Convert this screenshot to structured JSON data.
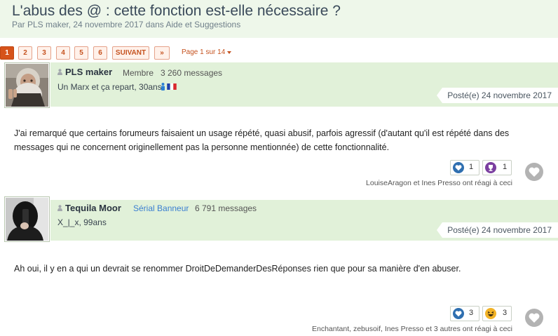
{
  "thread": {
    "title": "L'abus des @ : cette fonction est-elle nécessaire ?",
    "meta": "Par PLS maker, 24 novembre 2017 dans Aide et Suggestions"
  },
  "pagination": {
    "pages": [
      "1",
      "2",
      "3",
      "4",
      "5",
      "6"
    ],
    "current": "1",
    "next_label": "SUIVANT",
    "last_label": "»",
    "page_of": "Page 1 sur 14"
  },
  "posts": [
    {
      "author": "PLS maker",
      "rank": "Membre",
      "messages": "3 260 messages",
      "signature": "Un Marx et ça repart, 30ans",
      "date": "Posté(e) 24 novembre 2017",
      "body": "J'ai remarqué que certains forumeurs faisaient un usage répété, quasi abusif, parfois agressif (d'autant qu'il est répété dans des messages qui ne concernent originellement pas la personne mentionnée) de cette fonctionnalité.",
      "reactions": [
        {
          "icon": "thumbs-up-icon",
          "count": "1"
        },
        {
          "icon": "trophy-icon",
          "count": "1"
        }
      ],
      "reacted_by": "LouiseAragon et Ines Presso ont réagi à ceci"
    },
    {
      "author": "Tequila Moor",
      "rank": "Sérial Banneur",
      "messages": "6 791 messages",
      "signature": "X_|_x, 99ans",
      "date": "Posté(e) 24 novembre 2017",
      "body": "Ah oui, il y en a qui un devrait se renommer DroitDeDemanderDesRéponses rien que pour sa manière d'en abuser.",
      "reactions": [
        {
          "icon": "thumbs-up-icon",
          "count": "3"
        },
        {
          "icon": "laughing-face-icon",
          "count": "3"
        }
      ],
      "reacted_by": "Enchantant, zebusoif, Ines Presso et 3 autres ont réagi à ceci"
    }
  ],
  "colors": {
    "accent": "#d6531a",
    "header_bg": "#e1f1d9",
    "rank_special": "#3b7fd1",
    "reaction_blue": "#2f6fb0"
  }
}
